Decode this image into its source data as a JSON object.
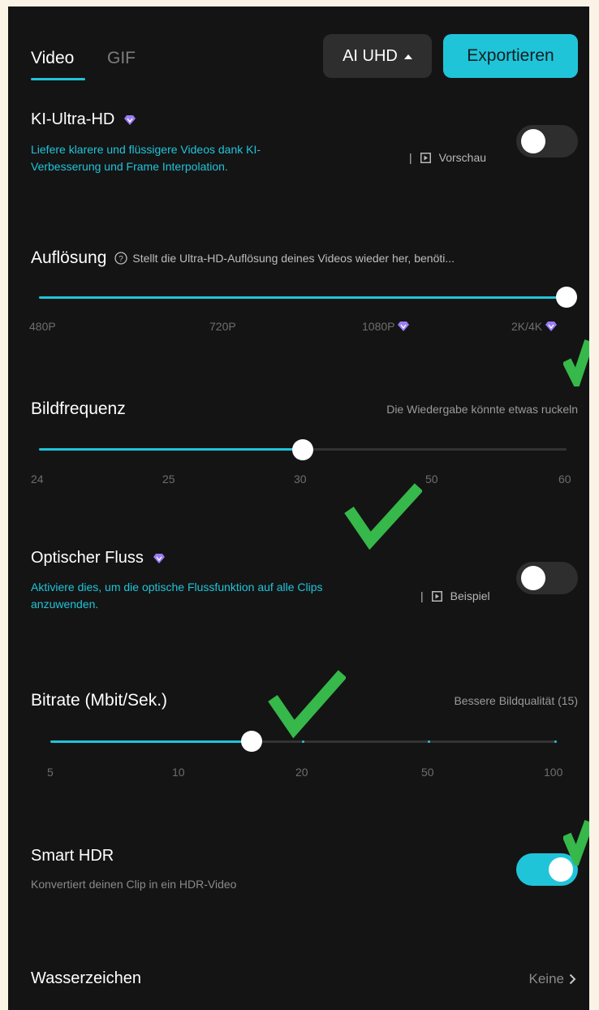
{
  "tabs": [
    {
      "label": "Video",
      "active": true
    },
    {
      "label": "GIF",
      "active": false
    }
  ],
  "toolbar": {
    "quality_label": "AI UHD",
    "export_label": "Exportieren"
  },
  "ki_ultra_hd": {
    "title": "KI-Ultra-HD",
    "description_line1": "Liefere klarere und flüssigere Videos dank KI-",
    "description_line2": "Verbesserung und Frame Interpolation.",
    "separator": "|",
    "preview_label": "Vorschau",
    "enabled": false
  },
  "resolution": {
    "title": "Auflösung",
    "hint": "Stellt die Ultra-HD-Auflösung deines Videos wieder her, benöti...",
    "ticks": [
      "480P",
      "720P",
      "1080P",
      "2K/4K"
    ],
    "selected": "2K/4K"
  },
  "frame_rate": {
    "title": "Bildfrequenz",
    "hint": "Die Wiedergabe könnte etwas ruckeln",
    "ticks": [
      "24",
      "25",
      "30",
      "50",
      "60"
    ],
    "selected": "30"
  },
  "optical_flow": {
    "title": "Optischer Fluss",
    "description_line1": "Aktiviere dies, um die optische Flussfunktion auf alle Clips",
    "description_line2": "anzuwenden.",
    "separator": "|",
    "example_label": "Beispiel",
    "enabled": false
  },
  "bitrate": {
    "title": "Bitrate (Mbit/Sek.)",
    "hint": "Bessere Bildqualität (15)",
    "ticks": [
      "5",
      "10",
      "20",
      "50",
      "100"
    ],
    "value": 15
  },
  "smart_hdr": {
    "title": "Smart HDR",
    "description": "Konvertiert deinen Clip in ein HDR-Video",
    "enabled": true
  },
  "watermark": {
    "title": "Wasserzeichen",
    "value": "Keine"
  },
  "colors": {
    "accent": "#20c4d9",
    "background": "#141414",
    "premium_gem": "#9b7cf5",
    "check_mark": "#36b84a"
  }
}
